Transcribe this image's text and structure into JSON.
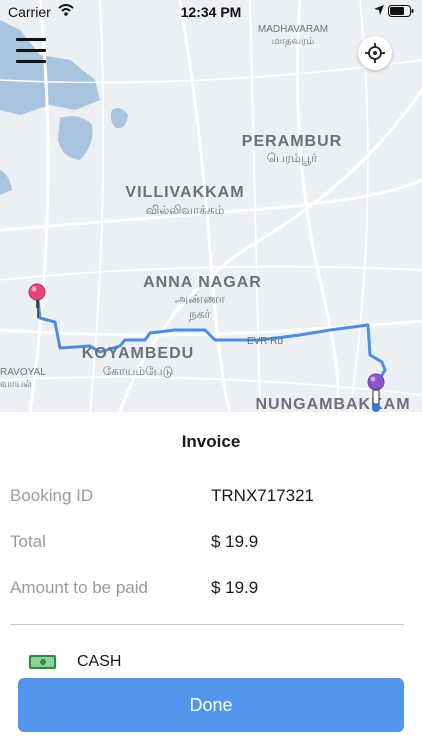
{
  "status_bar": {
    "carrier": "Carrier",
    "time": "12:34 PM"
  },
  "map": {
    "labels": [
      {
        "id": "madhavaram",
        "text": "MADHAVARAM"
      },
      {
        "id": "madhavaram_ta",
        "text": "மாதவரம்"
      },
      {
        "id": "perambur",
        "text": "PERAMBUR"
      },
      {
        "id": "perambur_ta",
        "text": "பெரம்பூர்"
      },
      {
        "id": "villivakkam",
        "text": "VILLIVAKKAM"
      },
      {
        "id": "villivakkam_ta",
        "text": "வில்லிவாக்கம்"
      },
      {
        "id": "anna_nagar",
        "text": "ANNA NAGAR"
      },
      {
        "id": "anna_nagar_ta1",
        "text": "அண்ணா"
      },
      {
        "id": "anna_nagar_ta2",
        "text": "நகர்"
      },
      {
        "id": "koyambedu",
        "text": "KOYAMBEDU"
      },
      {
        "id": "koyambedu_ta",
        "text": "கோயம்பேடு"
      },
      {
        "id": "evr_rd",
        "text": "EVR Rd"
      },
      {
        "id": "nungambakkam",
        "text": "NUNGAMBAKKAM"
      },
      {
        "id": "ravoyal",
        "text": "RAVOYAL"
      },
      {
        "id": "ravoyal_ta",
        "text": "வாயல்"
      }
    ],
    "colors": {
      "route": "#4a8fe0",
      "pickup_pin": "#e8457a",
      "drop_pin": "#8a57c8",
      "water": "#a9c4de"
    }
  },
  "invoice": {
    "title": "Invoice",
    "rows": [
      {
        "label": "Booking ID",
        "value": "TRNX717321"
      },
      {
        "label": "Total",
        "value": "$ 19.9"
      },
      {
        "label": "Amount to be paid",
        "value": "$ 19.9"
      }
    ],
    "payment_method": "CASH",
    "done_label": "Done"
  },
  "colors": {
    "accent": "#5295ec"
  }
}
